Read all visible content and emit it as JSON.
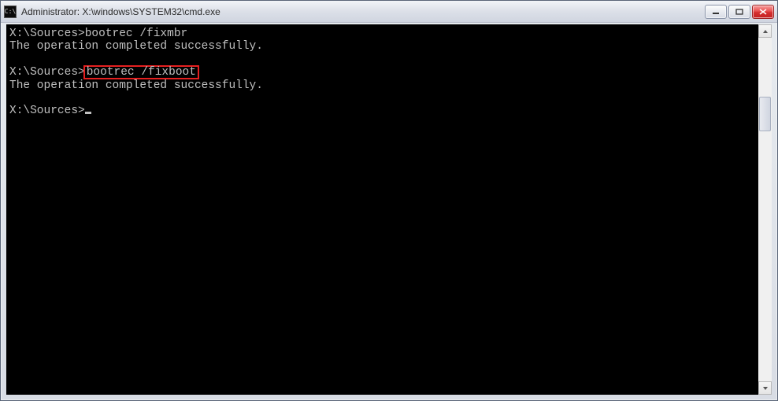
{
  "window": {
    "title": "Administrator: X:\\windows\\SYSTEM32\\cmd.exe",
    "icon_label": "C:\\"
  },
  "terminal": {
    "prompt": "X:\\Sources>",
    "lines": [
      {
        "prompt": "X:\\Sources>",
        "command": "bootrec /fixmbr",
        "highlighted": false
      },
      {
        "output": "The operation completed successfully."
      },
      {
        "blank": true
      },
      {
        "prompt": "X:\\Sources>",
        "command": "bootrec /fixboot",
        "highlighted": true
      },
      {
        "output": "The operation completed successfully."
      },
      {
        "blank": true
      },
      {
        "prompt": "X:\\Sources>",
        "cursor": true
      }
    ]
  },
  "colors": {
    "terminal_bg": "#000000",
    "terminal_fg": "#c0c0c0",
    "highlight_border": "#e62020"
  }
}
